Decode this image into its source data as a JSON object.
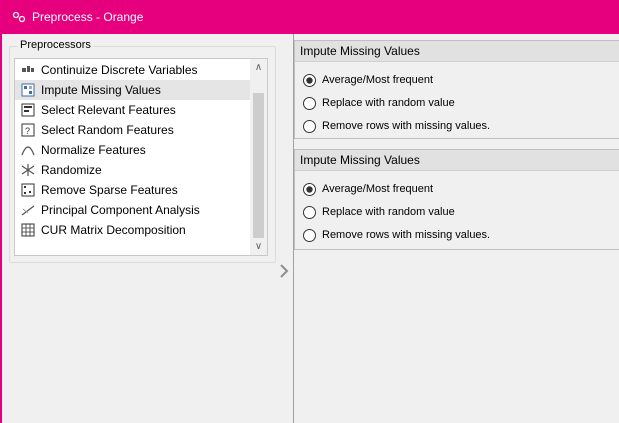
{
  "window": {
    "title": "Preprocess - Orange",
    "icon": "orange-app-icon"
  },
  "preprocessors": {
    "group_title": "Preprocessors",
    "items": [
      {
        "label": "Continuize Discrete Variables",
        "icon": "continuize-icon",
        "selected": false
      },
      {
        "label": "Impute Missing Values",
        "icon": "impute-icon",
        "selected": true
      },
      {
        "label": "Select Relevant Features",
        "icon": "select-relevant-icon",
        "selected": false
      },
      {
        "label": "Select Random Features",
        "icon": "select-random-icon",
        "selected": false
      },
      {
        "label": "Normalize Features",
        "icon": "normalize-icon",
        "selected": false
      },
      {
        "label": "Randomize",
        "icon": "randomize-icon",
        "selected": false
      },
      {
        "label": "Remove Sparse Features",
        "icon": "remove-sparse-icon",
        "selected": false
      },
      {
        "label": "Principal Component Analysis",
        "icon": "pca-icon",
        "selected": false
      },
      {
        "label": "CUR Matrix Decomposition",
        "icon": "cur-icon",
        "selected": false
      }
    ]
  },
  "panels": [
    {
      "title": "Impute Missing Values",
      "options": [
        {
          "label": "Average/Most frequent",
          "checked": true
        },
        {
          "label": "Replace with random value",
          "checked": false
        },
        {
          "label": "Remove rows with missing values.",
          "checked": false
        }
      ]
    },
    {
      "title": "Impute Missing Values",
      "options": [
        {
          "label": "Average/Most frequent",
          "checked": true
        },
        {
          "label": "Replace with random value",
          "checked": false
        },
        {
          "label": "Remove rows with missing values.",
          "checked": false
        }
      ]
    }
  ],
  "colors": {
    "title_bar": "#e6007e",
    "selection": "#e5e5e5"
  }
}
